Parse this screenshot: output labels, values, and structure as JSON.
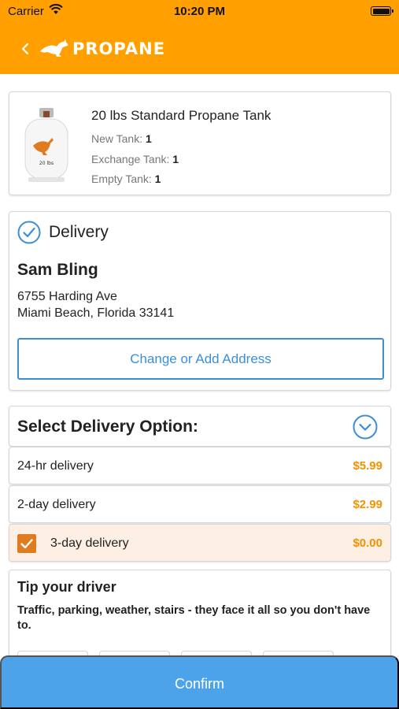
{
  "status_bar": {
    "carrier": "Carrier",
    "time": "10:20 PM"
  },
  "nav": {
    "logo_text": "PROPANE"
  },
  "product": {
    "title": "20 lbs Standard Propane Tank",
    "tank_label": "20 lbs",
    "new_tank_label": "New Tank:",
    "new_tank_value": "1",
    "exchange_tank_label": "Exchange Tank:",
    "exchange_tank_value": "1",
    "empty_tank_label": "Empty Tank:",
    "empty_tank_value": "1"
  },
  "delivery": {
    "heading": "Delivery",
    "name": "Sam Bling",
    "address_line1": "6755 Harding Ave",
    "address_line2": "Miami Beach, Florida 33141",
    "change_address_label": "Change or Add Address"
  },
  "delivery_options": {
    "heading": "Select Delivery Option:",
    "options": [
      {
        "name": "24-hr delivery",
        "price": "$5.99",
        "selected": false
      },
      {
        "name": "2-day delivery",
        "price": "$2.99",
        "selected": false
      },
      {
        "name": "3-day delivery",
        "price": "$0.00",
        "selected": true
      }
    ]
  },
  "tip": {
    "title": "Tip your driver",
    "description": "Traffic, parking, weather, stairs - they face it all so you don't have to."
  },
  "confirm_label": "Confirm",
  "colors": {
    "brand_orange": "#ffa000",
    "accent_blue": "#3a8fd9",
    "confirm_blue": "#4da3ea",
    "price_orange": "#f39200",
    "selected_bg": "#fdefe3"
  },
  "icons": [
    "wifi-icon",
    "battery-icon",
    "back-chevron-icon",
    "kangaroo-logo-icon",
    "check-circle-icon",
    "chevron-down-circle-icon",
    "checkbox-checked-icon"
  ]
}
